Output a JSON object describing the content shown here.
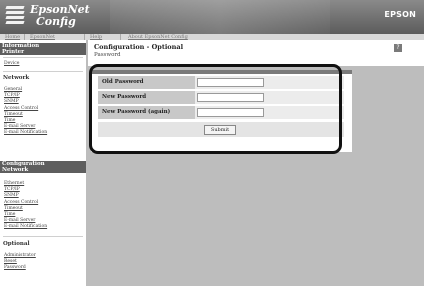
{
  "header": {
    "logo_line1": "EpsonNet",
    "logo_line2": "Config",
    "brand": "EPSON"
  },
  "menu": {
    "home": "Home",
    "epsonnet": "EpsonNet",
    "help": "Help",
    "about": "About EpsonNet Config"
  },
  "sidebar": {
    "information_head": "Information",
    "information_sub": "Printer",
    "info_printer_links": [
      "Device"
    ],
    "info_network_title": "Network",
    "info_network_links": [
      "General",
      "TCP/IP",
      "SNMP",
      "Access Control",
      "Timeout",
      "Time",
      "E-mail Server",
      "E-mail Notification"
    ],
    "configuration_head": "Configuration",
    "configuration_sub": "Network",
    "config_network_links": [
      "Ethernet",
      "TCP/IP",
      "SNMP",
      "Access Control",
      "Timeout",
      "Time",
      "E-mail Server",
      "E-mail Notification"
    ],
    "optional_title": "Optional",
    "optional_links": [
      "Administrator",
      "Reset",
      "Password"
    ]
  },
  "page": {
    "title": "Configuration - Optional",
    "subtitle": "Password",
    "help_icon": "?"
  },
  "form": {
    "rows": [
      {
        "label": "Old Password",
        "value": ""
      },
      {
        "label": "New Password",
        "value": ""
      },
      {
        "label": "New Password (again)",
        "value": ""
      }
    ],
    "submit_label": "Submit"
  }
}
